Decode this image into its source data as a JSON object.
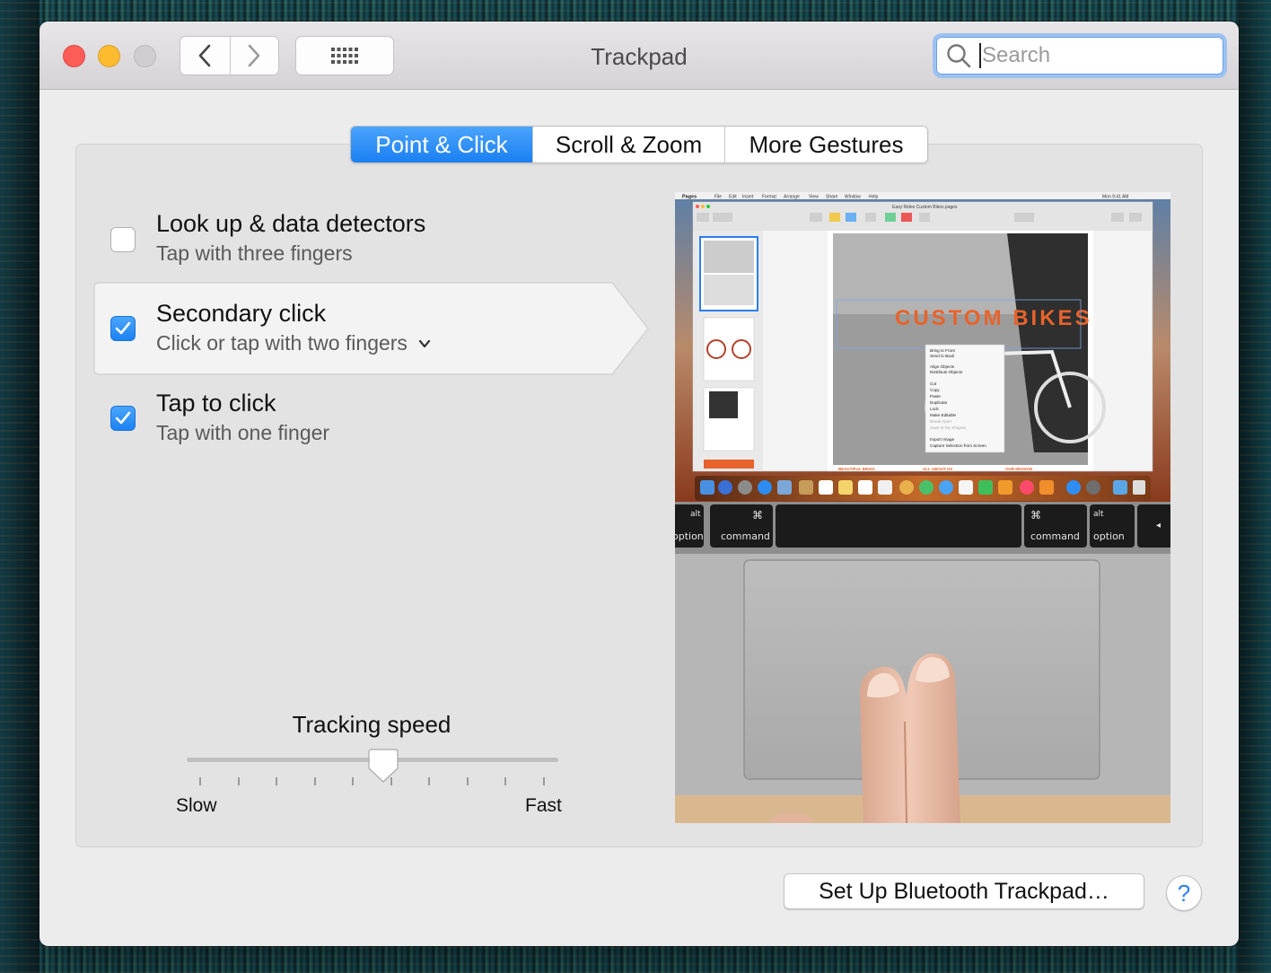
{
  "window": {
    "title": "Trackpad"
  },
  "toolbar": {
    "back_icon": "chevron-left-icon",
    "forward_icon": "chevron-right-icon",
    "show_all_icon": "grid-icon"
  },
  "search": {
    "placeholder": "Search",
    "value": ""
  },
  "tabs": [
    {
      "label": "Point & Click",
      "active": true
    },
    {
      "label": "Scroll & Zoom",
      "active": false
    },
    {
      "label": "More Gestures",
      "active": false
    }
  ],
  "options": [
    {
      "title": "Look up & data detectors",
      "subtitle": "Tap with three fingers",
      "checked": false
    },
    {
      "title": "Secondary click",
      "subtitle": "Click or tap with two fingers",
      "checked": true,
      "selected": true
    },
    {
      "title": "Tap to click",
      "subtitle": "Tap with one finger",
      "checked": true
    }
  ],
  "tracking": {
    "label": "Tracking speed",
    "min_label": "Slow",
    "max_label": "Fast",
    "value_fraction": 0.53
  },
  "preview": {
    "menu_app": "Pages",
    "menu_items": [
      "File",
      "Edit",
      "Insert",
      "Format",
      "Arrange",
      "View",
      "Share",
      "Window",
      "Help"
    ],
    "clock": "Mon 9:41 AM",
    "doc_title": "Easy Rides Custom Bikes.pages",
    "doc_heading": "CUSTOM BIKES",
    "context_menu": [
      "Bring to Front",
      "Send to Back",
      "Align Objects",
      "Distribute Objects",
      "Cut",
      "Copy",
      "Paste",
      "Duplicate",
      "Lock",
      "Make Editable",
      "Break Apart",
      "Save to My Shapes",
      "Import Image",
      "Capture Selection from Screen"
    ],
    "keys": {
      "left_alt": "alt",
      "left_option": "option",
      "left_command": "command",
      "right_command": "command",
      "right_alt": "alt",
      "right_option": "option",
      "command_symbol": "⌘",
      "arrow": "◂"
    },
    "footer_labels": [
      "BEAUTIFUL BIKES.",
      "ALL ABOUT US",
      "OUR MISSION"
    ]
  },
  "footer": {
    "bluetooth_button": "Set Up Bluetooth Trackpad…",
    "help_label": "?"
  },
  "colors": {
    "accent": "#1b7ff2",
    "close": "#fc5d57",
    "minimize": "#fdbb2f",
    "zoom": "#d0ced0",
    "heading_orange": "#e8632b"
  }
}
